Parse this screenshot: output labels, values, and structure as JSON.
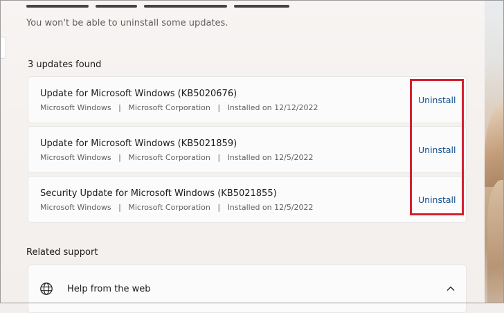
{
  "subtitle": "You won't be able to uninstall some updates.",
  "updates_count_label": "3 updates found",
  "updates": [
    {
      "title": "Update for Microsoft Windows (KB5020676)",
      "meta": "Microsoft Windows   |   Microsoft Corporation   |   Installed on 12/12/2022",
      "action": "Uninstall"
    },
    {
      "title": "Update for Microsoft Windows (KB5021859)",
      "meta": "Microsoft Windows   |   Microsoft Corporation   |   Installed on 12/5/2022",
      "action": "Uninstall"
    },
    {
      "title": "Security Update for Microsoft Windows (KB5021855)",
      "meta": "Microsoft Windows   |   Microsoft Corporation   |   Installed on 12/5/2022",
      "action": "Uninstall"
    }
  ],
  "related_support": {
    "heading": "Related support",
    "items": [
      {
        "label": "Help from the web",
        "icon": "globe-icon"
      }
    ]
  },
  "colors": {
    "link": "#0f4f8c",
    "highlight": "#d2202f",
    "card": "#fbfbfb"
  }
}
